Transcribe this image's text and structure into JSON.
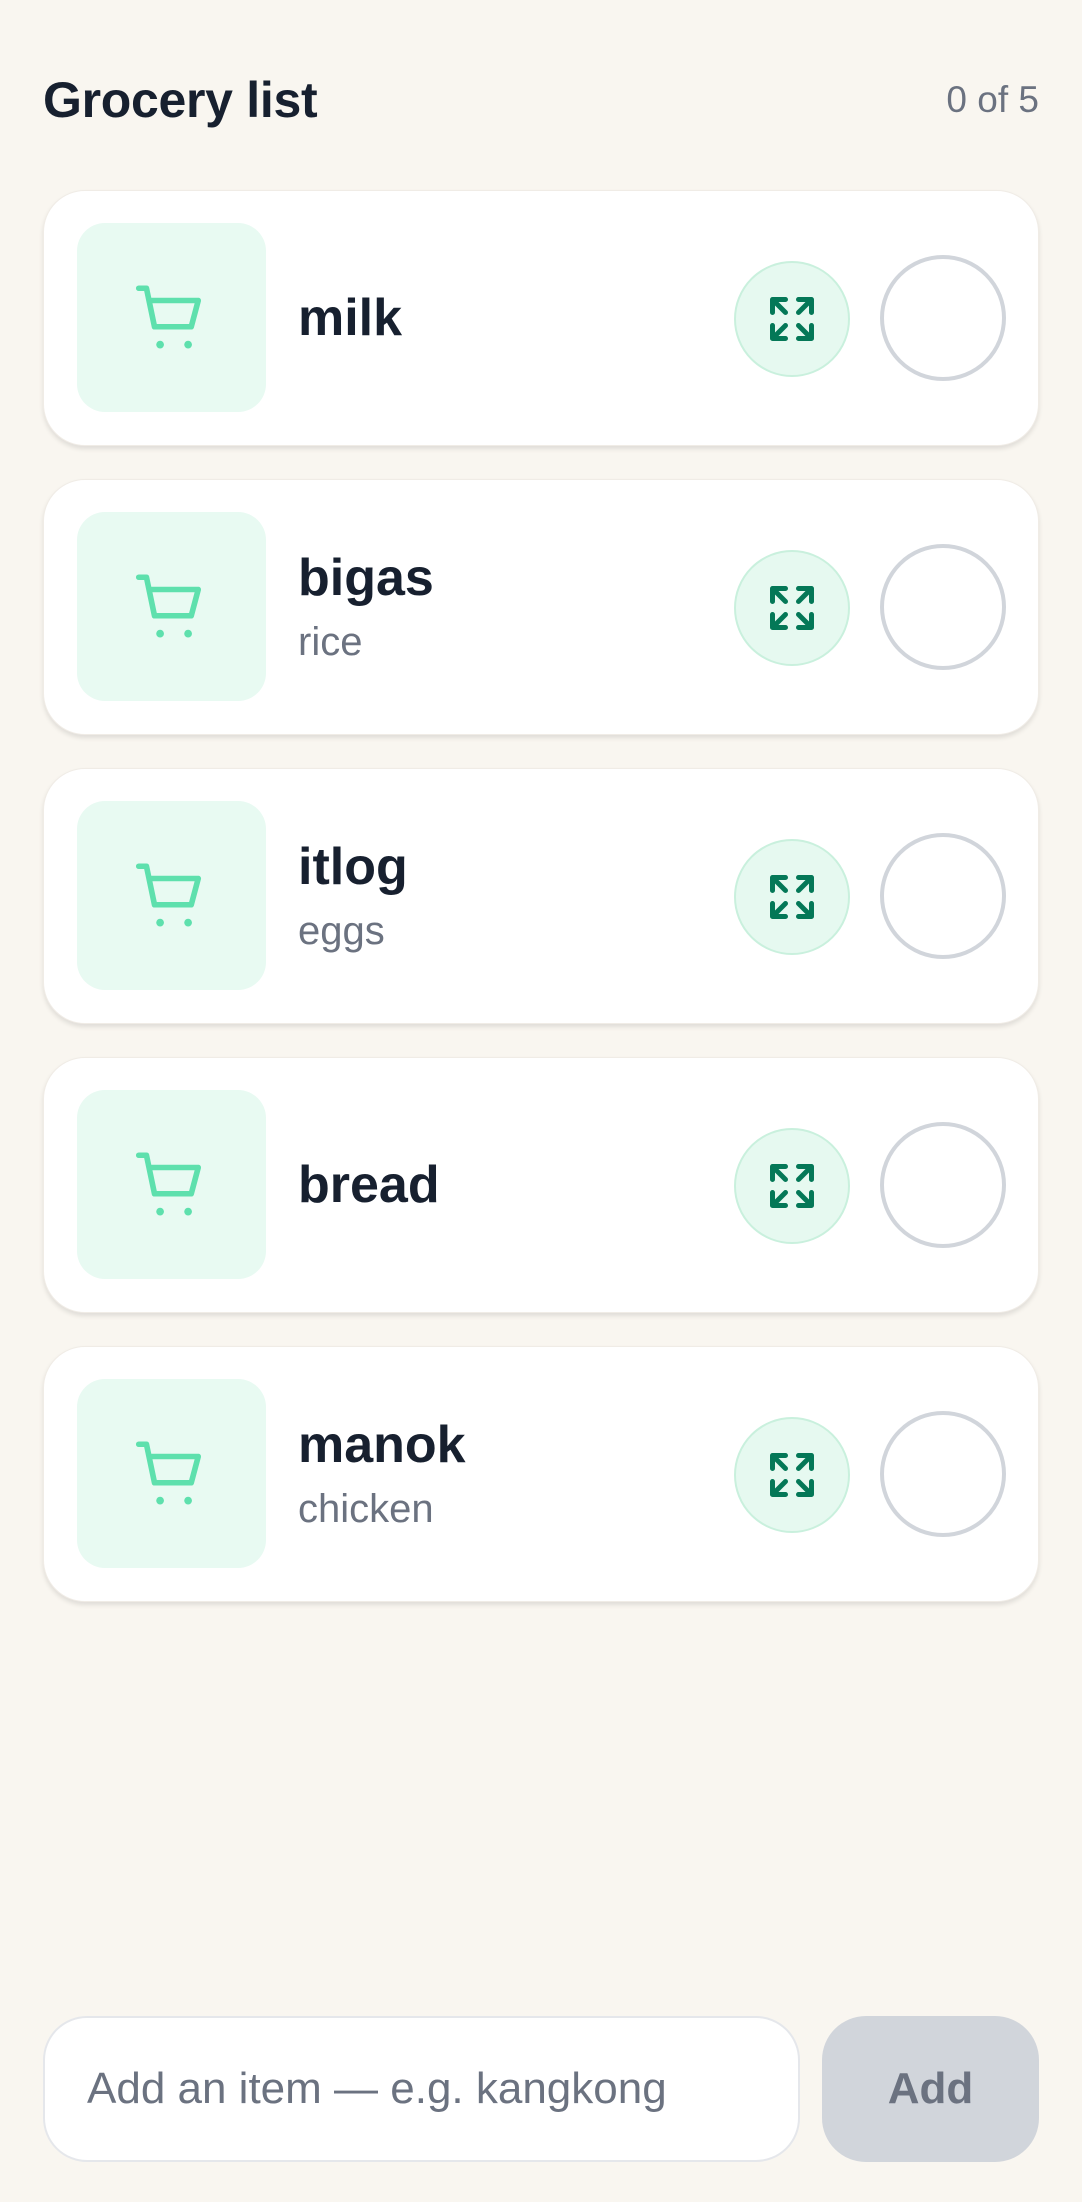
{
  "header": {
    "title": "Grocery list",
    "counter": "0 of 5"
  },
  "colors": {
    "background": "#f9f6f0",
    "accent": "#34d399",
    "accent_dark": "#047857",
    "thumb_bg": "#e8faf2"
  },
  "items": [
    {
      "name": "milk",
      "subtitle": "",
      "icon": "cart-icon",
      "action_icon": "expand-icon",
      "checked": false
    },
    {
      "name": "bigas",
      "subtitle": "rice",
      "icon": "cart-icon",
      "action_icon": "expand-icon",
      "checked": false
    },
    {
      "name": "itlog",
      "subtitle": "eggs",
      "icon": "cart-icon",
      "action_icon": "expand-icon",
      "checked": false
    },
    {
      "name": "bread",
      "subtitle": "",
      "icon": "cart-icon",
      "action_icon": "expand-icon",
      "checked": false
    },
    {
      "name": "manok",
      "subtitle": "chicken",
      "icon": "cart-icon",
      "action_icon": "expand-icon",
      "checked": false
    }
  ],
  "footer": {
    "input_placeholder": "Add an item — e.g. kangkong",
    "input_value": "",
    "add_label": "Add"
  }
}
